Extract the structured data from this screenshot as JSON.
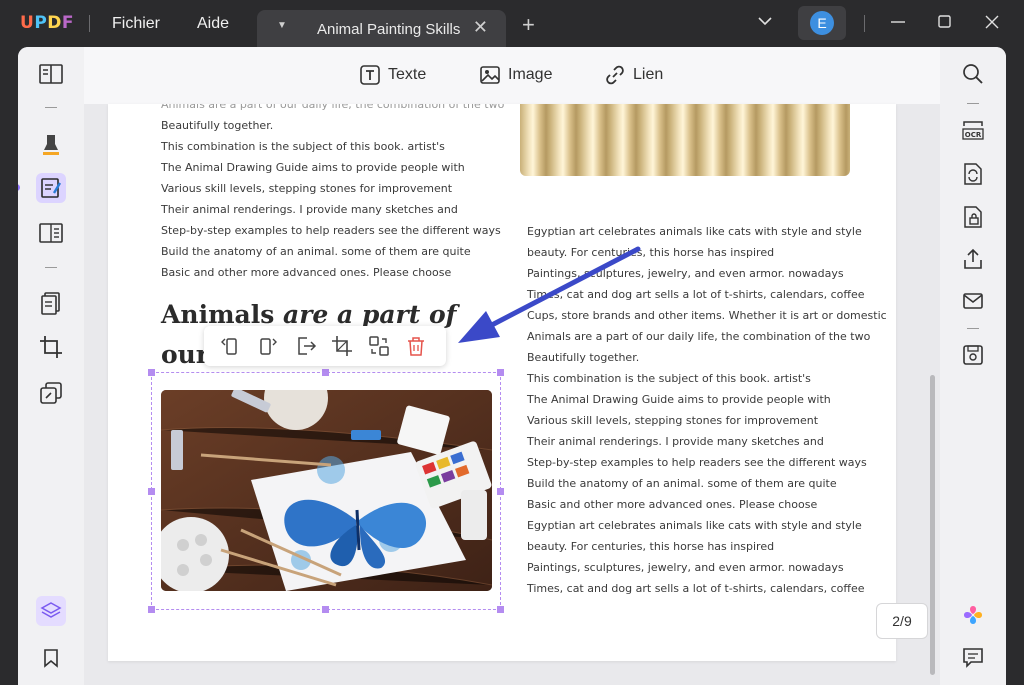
{
  "app": {
    "logo": "UPDF"
  },
  "menu": {
    "file": "Fichier",
    "help": "Aide"
  },
  "tab": {
    "title": "Animal Painting Skills"
  },
  "user": {
    "avatar_letter": "E"
  },
  "toolbar": {
    "text_label": "Texte",
    "image_label": "Image",
    "link_label": "Lien"
  },
  "left_column_lines": [
    "Beautifully together.",
    "This combination is the subject of this book. artist's",
    "The Animal Drawing Guide aims to provide people with",
    "Various skill levels, stepping stones for improvement",
    "Their animal renderings. I provide many sketches and",
    "Step-by-step examples to help readers see the different ways",
    "Build the anatomy of an animal. some of them are quite",
    "Basic and other more advanced ones. Please choose"
  ],
  "heading": {
    "line1_normal": "Animals ",
    "line1_italic": "are a part of",
    "line2": "our"
  },
  "right_column_lines": [
    "Egyptian art celebrates animals like cats with style and style",
    "beauty. For centuries, this horse has inspired",
    "Paintings, sculptures, jewelry, and even armor. nowadays",
    "Times, cat and dog art sells a lot of t-shirts, calendars, coffee",
    "Cups, store brands and other items. Whether it is art or domestic",
    "Animals are a part of our daily life, the combination of the two",
    "Beautifully together.",
    "This combination is the subject of this book. artist's",
    "The Animal Drawing Guide aims to provide people with",
    "Various skill levels, stepping stones for improvement",
    "Their animal renderings. I provide many sketches and",
    "Step-by-step examples to help readers see the different ways",
    "Build the anatomy of an animal. some of them are quite",
    "Basic and other more advanced ones. Please choose",
    "Egyptian art celebrates animals like cats with style and style",
    "beauty. For centuries, this horse has inspired",
    "Paintings, sculptures, jewelry, and even armor. nowadays",
    "Times, cat and dog art sells a lot of t-shirts, calendars, coffee"
  ],
  "page_indicator": "2/9",
  "colors": {
    "accent": "#8e72ff",
    "selection": "#b48cf0",
    "delete": "#e5534b",
    "arrow": "#3b49c8"
  }
}
